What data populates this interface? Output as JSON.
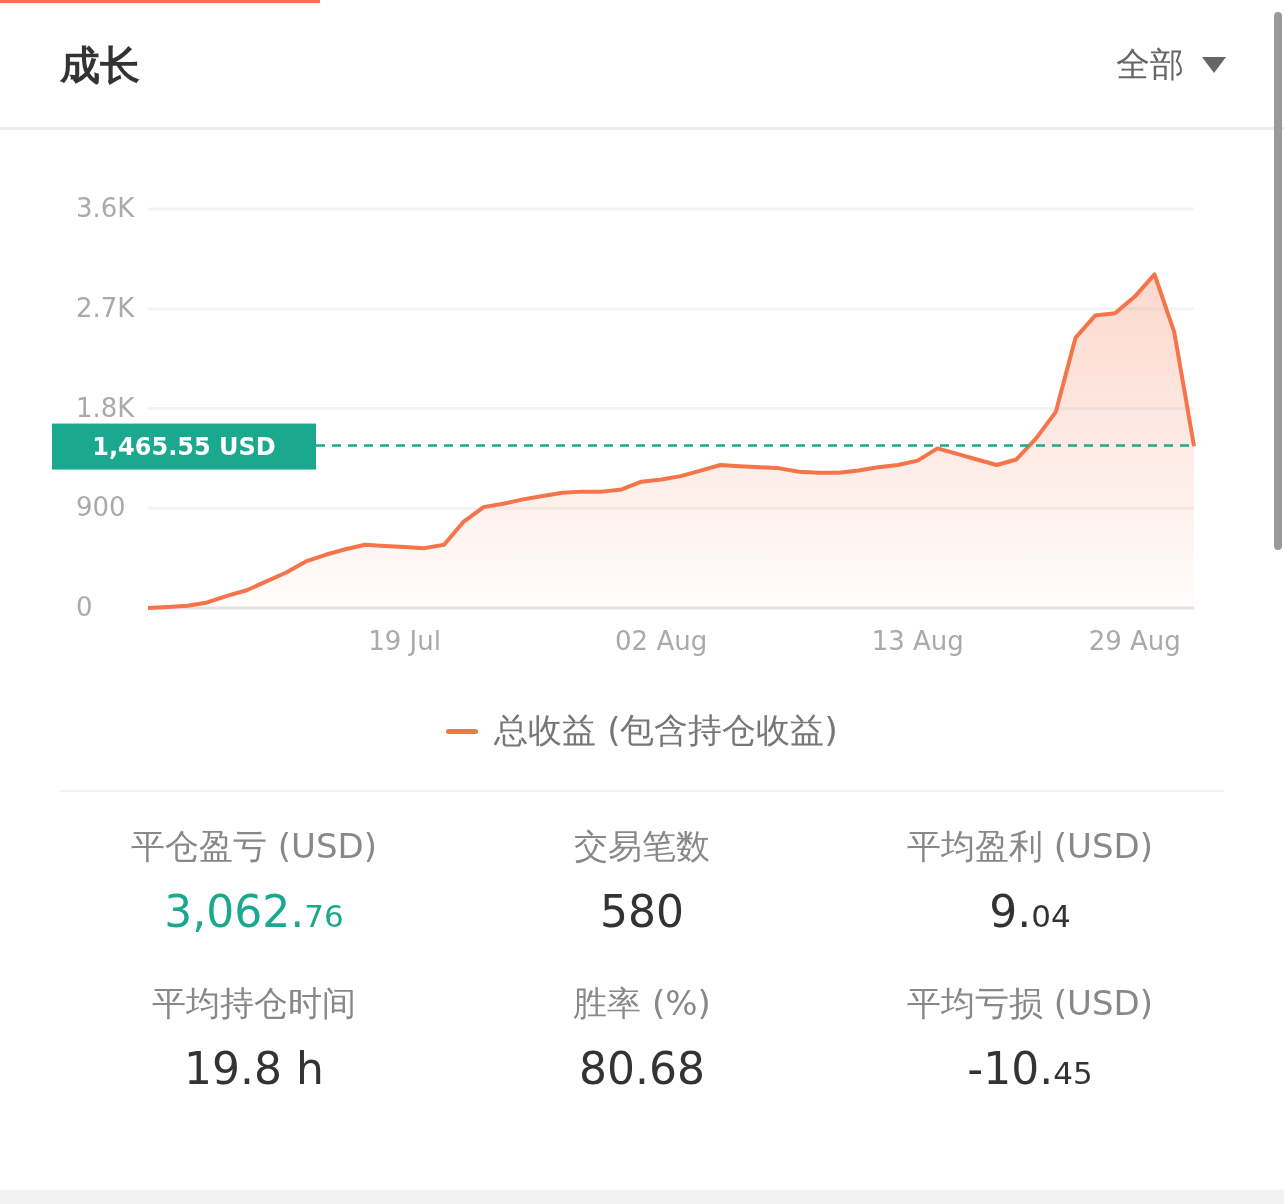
{
  "header": {
    "title": "成长",
    "filter": "全部"
  },
  "chart": {
    "chart_data": {
      "type": "area",
      "categories": [
        null,
        null,
        null,
        null,
        null,
        null,
        null,
        null,
        null,
        null,
        null,
        null,
        null,
        "19 Jul",
        null,
        null,
        null,
        null,
        null,
        null,
        null,
        null,
        null,
        null,
        null,
        null,
        "02 Aug",
        null,
        null,
        null,
        null,
        null,
        null,
        null,
        null,
        null,
        null,
        null,
        null,
        "13 Aug",
        null,
        null,
        null,
        null,
        null,
        null,
        null,
        null,
        null,
        null,
        "29 Aug",
        null,
        null,
        null
      ],
      "series": [
        {
          "name": "总收益 (包含持仓收益)",
          "color": "#f5744a",
          "values": [
            0,
            10,
            20,
            50,
            110,
            160,
            240,
            320,
            420,
            480,
            530,
            570,
            560,
            550,
            540,
            570,
            780,
            910,
            940,
            980,
            1010,
            1040,
            1050,
            1050,
            1070,
            1140,
            1160,
            1190,
            1240,
            1290,
            1280,
            1270,
            1260,
            1230,
            1220,
            1220,
            1240,
            1270,
            1290,
            1330,
            1440,
            1390,
            1340,
            1290,
            1340,
            1530,
            1770,
            2440,
            2640,
            2660,
            2810,
            3010,
            2490,
            1460
          ]
        }
      ],
      "ylim": [
        0,
        3600
      ],
      "yticks": [
        {
          "value": 0,
          "label": "0"
        },
        {
          "value": 900,
          "label": "900"
        },
        {
          "value": 1800,
          "label": "1.8K"
        },
        {
          "value": 2700,
          "label": "2.7K"
        },
        {
          "value": 3600,
          "label": "3.6K"
        }
      ],
      "grid": true,
      "ref_lines": [
        {
          "axis": "y",
          "value": 1465.55,
          "color": "#1aa88e"
        }
      ],
      "annotations": [
        "1,465.55 USD"
      ]
    }
  },
  "stats": [
    {
      "label": "平仓盈亏 (USD)",
      "value": "3,062.",
      "decimals": "76",
      "color": "#1aa88e"
    },
    {
      "label": "交易笔数",
      "value": "580",
      "color": "#333333"
    },
    {
      "label": "平均盈利 (USD)",
      "value": "9.",
      "decimals": "04",
      "color": "#333333"
    },
    {
      "label": "平均持仓时间",
      "value": "19.8 h",
      "color": "#333333"
    },
    {
      "label": "胜率 (%)",
      "value": "80.68",
      "color": "#333333"
    },
    {
      "label": "平均亏损 (USD)",
      "value": "-10.",
      "decimals": "45",
      "color": "#333333"
    }
  ]
}
